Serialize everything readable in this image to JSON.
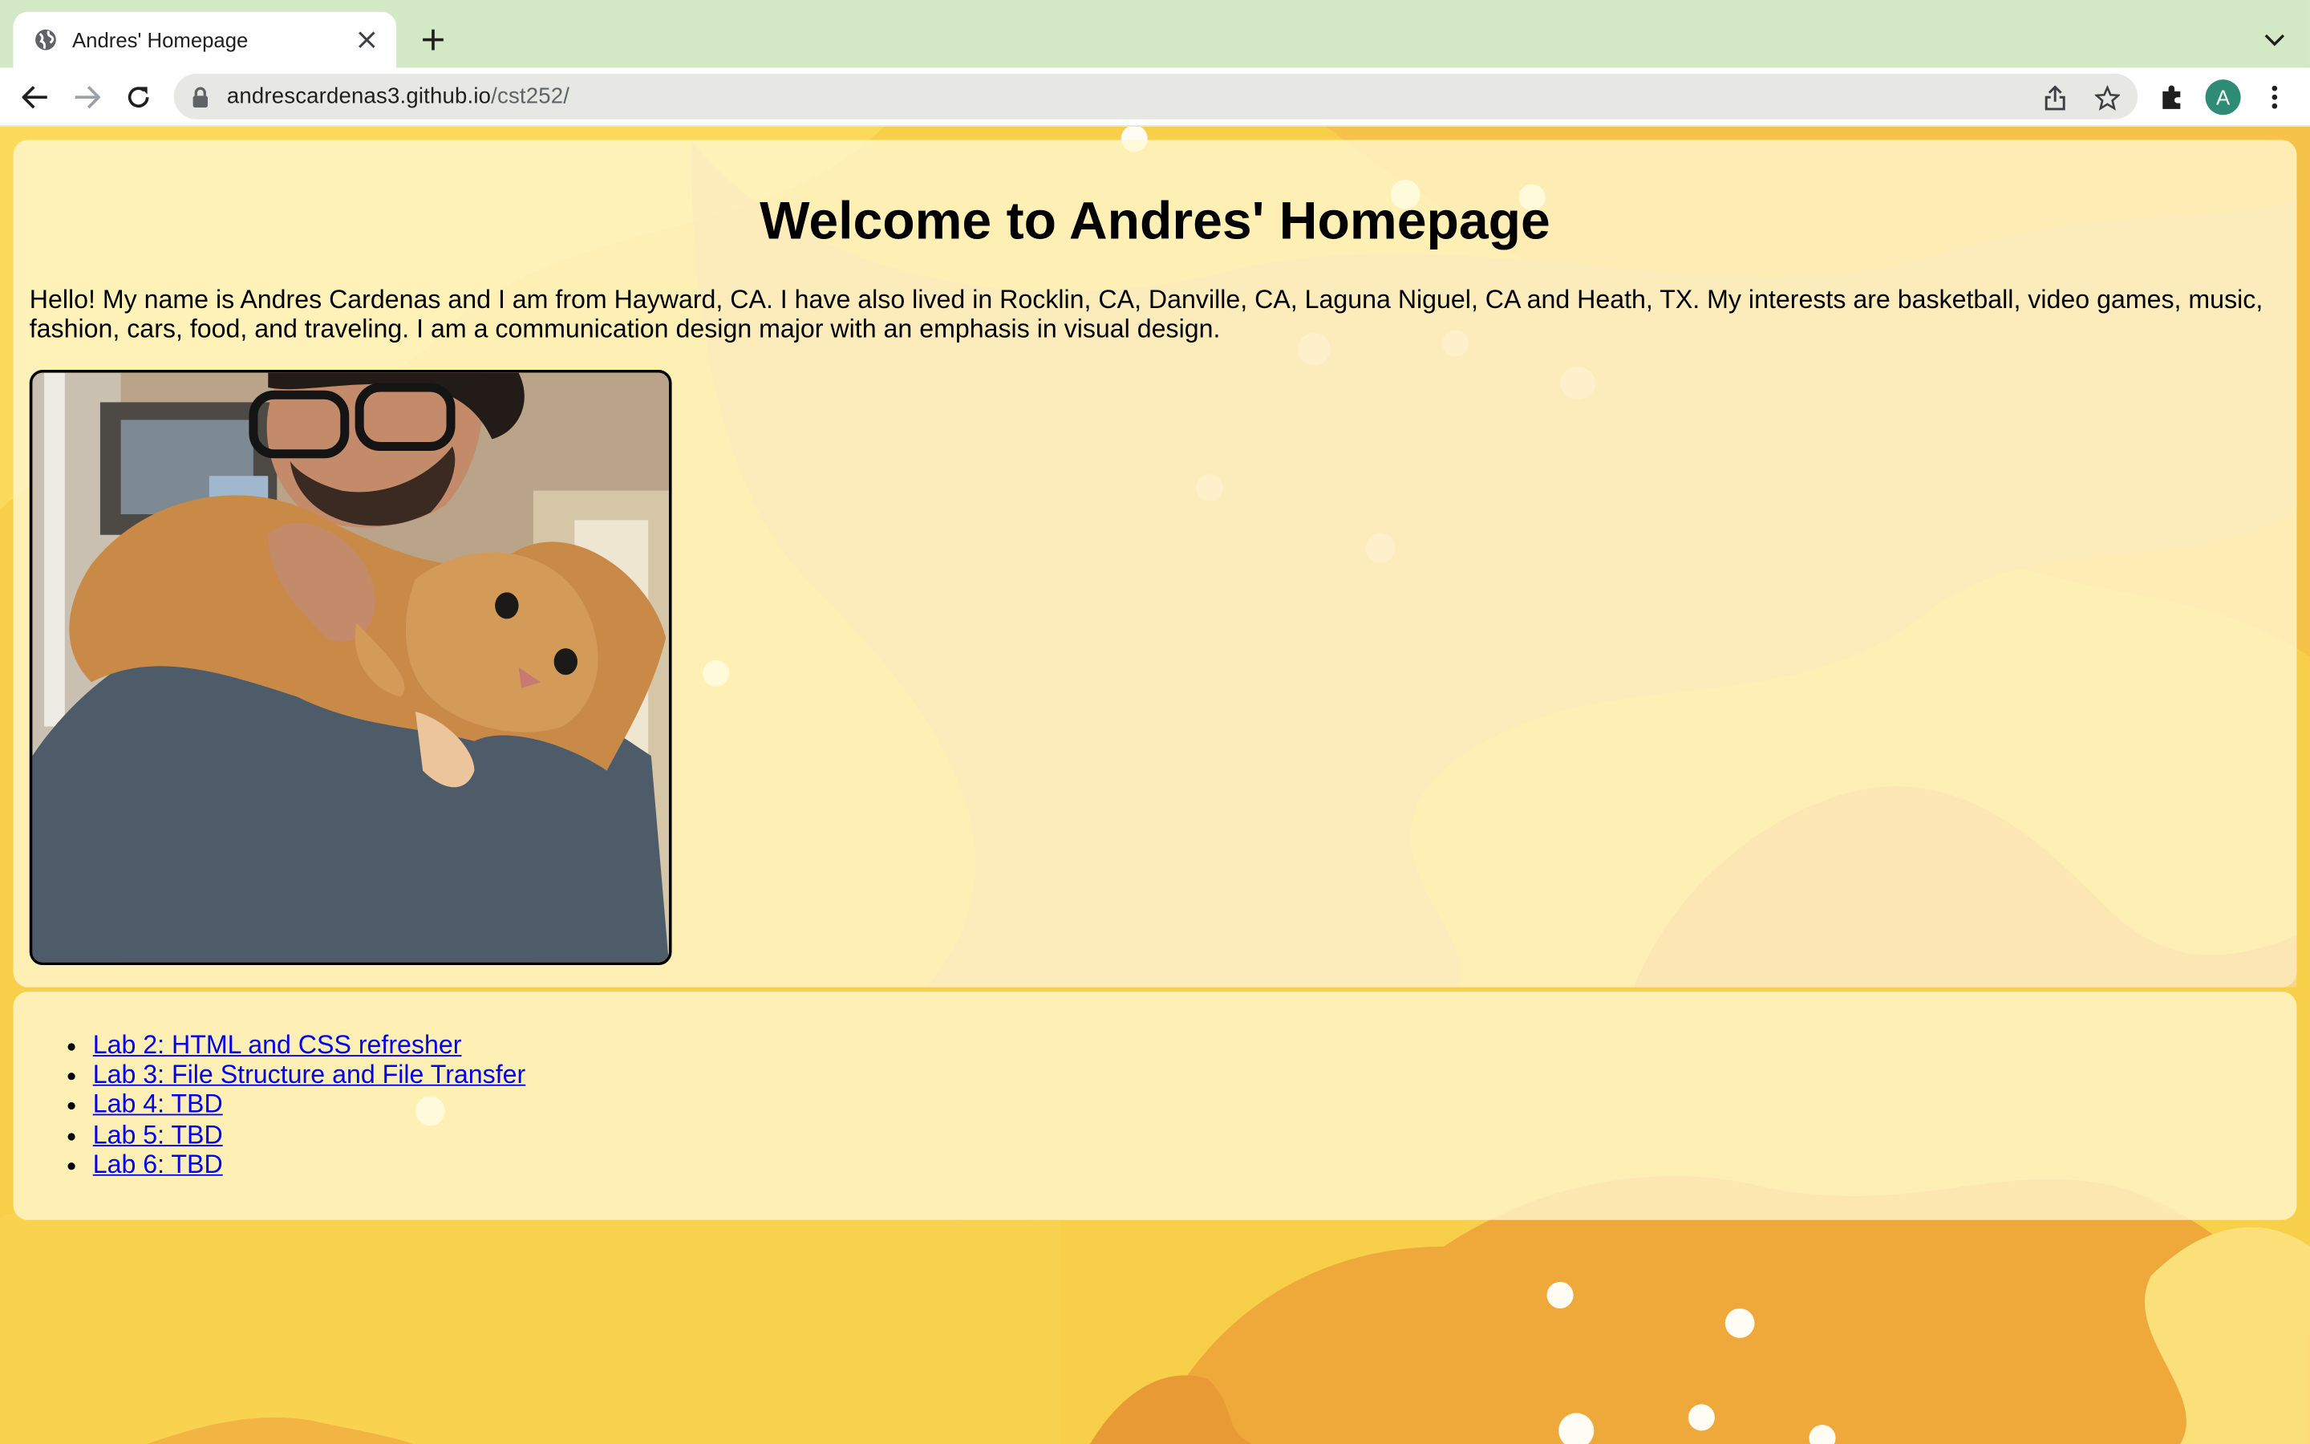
{
  "browser": {
    "tab_title": "Andres' Homepage",
    "url_host": "andrescardenas3.github.io",
    "url_path": "/cst252/",
    "profile_initial": "A",
    "colors": {
      "tabbar": "#d3e9c5",
      "omnibox": "#e7e8e3",
      "avatar": "#2e8b76"
    },
    "icons": [
      "globe-icon",
      "close-icon",
      "plus-icon",
      "chevron-down-icon",
      "back-arrow-icon",
      "forward-arrow-icon",
      "reload-icon",
      "lock-icon",
      "share-icon",
      "star-icon",
      "extensions-icon",
      "kebab-menu-icon"
    ]
  },
  "page": {
    "heading": "Welcome to Andres' Homepage",
    "intro": "Hello! My name is Andres Cardenas and I am from Hayward, CA. I have also lived in Rocklin, CA, Danville, CA, Laguna Niguel, CA and Heath, TX. My interests are basketball, video games, music, fashion, cars, food, and traveling. I am a communication design major with an emphasis in visual design.",
    "photo_description": "photo of a man holding an orange tabby cat",
    "links": [
      "Lab 2: HTML and CSS refresher",
      "Lab 3: File Structure and File Transfer",
      "Lab 4: TBD",
      "Lab 5: TBD",
      "Lab 6: TBD"
    ],
    "colors": {
      "background": "#f8cf48",
      "card": "#fff8d2",
      "link": "#0000ee"
    }
  }
}
